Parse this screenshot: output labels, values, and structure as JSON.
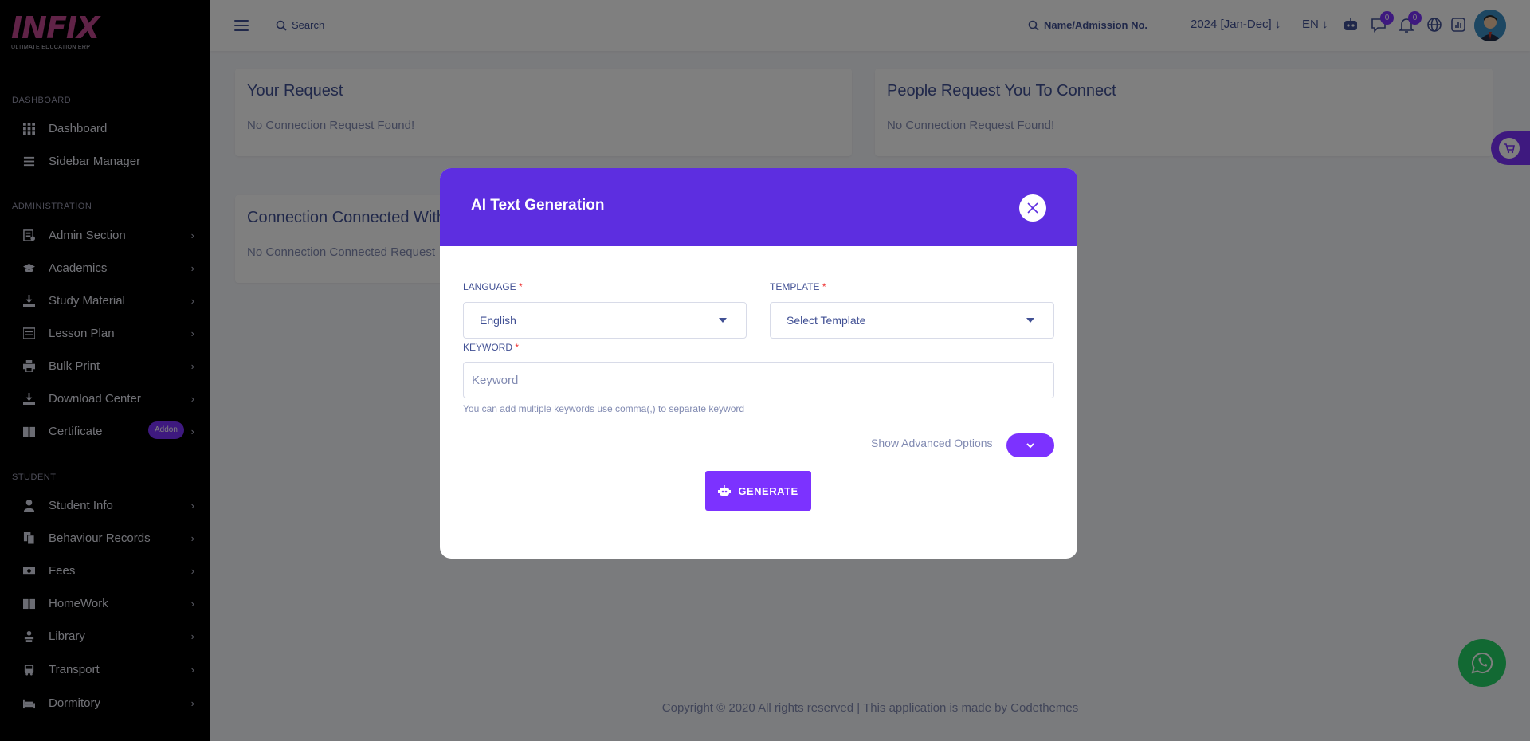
{
  "brand": {
    "logo_text": "INFIX",
    "logo_sub": "ULTIMATE EDUCATION ERP"
  },
  "sidebar": {
    "sections": [
      {
        "title": "DASHBOARD",
        "items": [
          {
            "label": "Dashboard",
            "icon": "grid-icon",
            "chevron": false
          },
          {
            "label": "Sidebar Manager",
            "icon": "menu-lines-icon",
            "chevron": false
          }
        ]
      },
      {
        "title": "ADMINISTRATION",
        "items": [
          {
            "label": "Admin Section",
            "icon": "admin-icon",
            "chevron": true
          },
          {
            "label": "Academics",
            "icon": "graduation-cap-icon",
            "chevron": true
          },
          {
            "label": "Study Material",
            "icon": "download-tray-icon",
            "chevron": true
          },
          {
            "label": "Lesson Plan",
            "icon": "list-box-icon",
            "chevron": true
          },
          {
            "label": "Bulk Print",
            "icon": "printer-icon",
            "chevron": true
          },
          {
            "label": "Download Center",
            "icon": "download-tray-icon",
            "chevron": true
          },
          {
            "label": "Certificate",
            "icon": "book-icon",
            "chevron": true,
            "badge": "Addon"
          }
        ]
      },
      {
        "title": "STUDENT",
        "items": [
          {
            "label": "Student Info",
            "icon": "user-icon",
            "chevron": true
          },
          {
            "label": "Behaviour Records",
            "icon": "files-icon",
            "chevron": true
          },
          {
            "label": "Fees",
            "icon": "money-icon",
            "chevron": true
          },
          {
            "label": "HomeWork",
            "icon": "book-icon",
            "chevron": true
          },
          {
            "label": "Library",
            "icon": "library-icon",
            "chevron": true
          },
          {
            "label": "Transport",
            "icon": "bus-icon",
            "chevron": true
          },
          {
            "label": "Dormitory",
            "icon": "bed-icon",
            "chevron": true
          }
        ]
      }
    ]
  },
  "header": {
    "search_label": "Search",
    "student_search_label": "Name/Admission No.",
    "session": "2024 [Jan-Dec]",
    "language": "EN",
    "chat_badge": "0",
    "notification_badge": "0"
  },
  "cards": {
    "your_request": {
      "title": "Your Request",
      "text": "No Connection Request Found!"
    },
    "people_request": {
      "title": "People Request You To Connect",
      "text": "No Connection Request Found!"
    },
    "connected": {
      "title": "Connection Connected With",
      "text": "No Connection Connected Request"
    }
  },
  "footer": {
    "text": "Copyright © 2020 All rights reserved | This application is made by Codethemes"
  },
  "modal": {
    "title": "AI Text Generation",
    "language_label": "LANGUAGE",
    "language_value": "English",
    "template_label": "TEMPLATE",
    "template_value": "Select Template",
    "keyword_label": "KEYWORD",
    "keyword_placeholder": "Keyword",
    "keyword_help": "You can add multiple keywords use comma(,) to separate keyword",
    "advanced_label": "Show Advanced Options",
    "generate_label": "GENERATE",
    "required_mark": "*"
  },
  "colors": {
    "accent": "#7c32ff",
    "modal_header": "#5d2ee0",
    "sidebar_bg": "#000000",
    "whatsapp": "#25d366"
  }
}
